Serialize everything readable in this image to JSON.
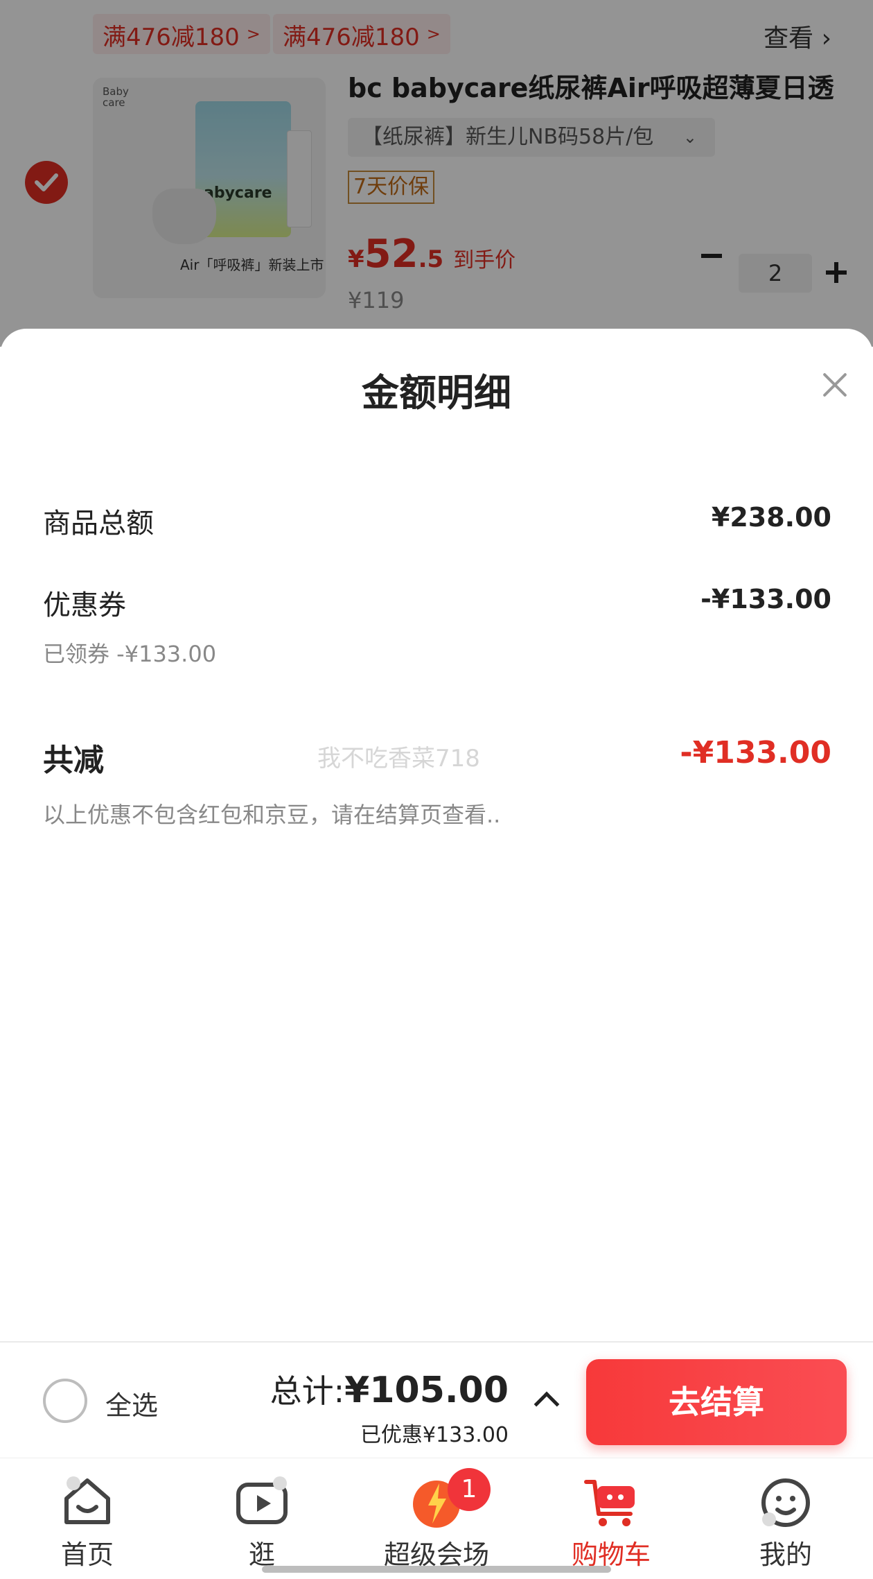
{
  "cart": {
    "promo_tags": [
      "满476减180",
      "满476减180"
    ],
    "view_link": "查看",
    "product": {
      "image_brand": "Baby care",
      "image_logo": "abycare",
      "image_caption": "Air「呼吸裤」新装上市",
      "title": "bc babycare纸尿裤Air呼吸超薄夏日透",
      "spec": "【纸尿裤】新生儿NB码58片/包",
      "protect_tag": "7天价保",
      "price_yen": "¥",
      "price_int": "52",
      "price_dec": ".5",
      "price_label": "到手价",
      "original_price": "¥119",
      "quantity": "2"
    }
  },
  "sheet": {
    "title": "金额明细",
    "goods_total_label": "商品总额",
    "goods_total_value": "¥238.00",
    "coupon_label": "优惠券",
    "coupon_value": "-¥133.00",
    "coupon_sub": "已领券 -¥133.00",
    "total_discount_label": "共减",
    "total_discount_value": "-¥133.00",
    "watermark": "我不吃香菜718",
    "note": "以上优惠不包含红包和京豆，请在结算页查看.."
  },
  "checkout": {
    "select_all_label": "全选",
    "total_label": "总计:",
    "total_value": "¥105.00",
    "saved": "已优惠¥133.00",
    "button_label": "去结算"
  },
  "nav": {
    "items": [
      {
        "label": "首页",
        "icon": "home-icon"
      },
      {
        "label": "逛",
        "icon": "video-icon"
      },
      {
        "label": "超级会场",
        "icon": "sale-icon",
        "badge": "1"
      },
      {
        "label": "购物车",
        "icon": "cart-icon",
        "active": true
      },
      {
        "label": "我的",
        "icon": "profile-icon"
      }
    ]
  },
  "colors": {
    "accent": "#e02e24",
    "checkout_button": "#f7393a"
  }
}
